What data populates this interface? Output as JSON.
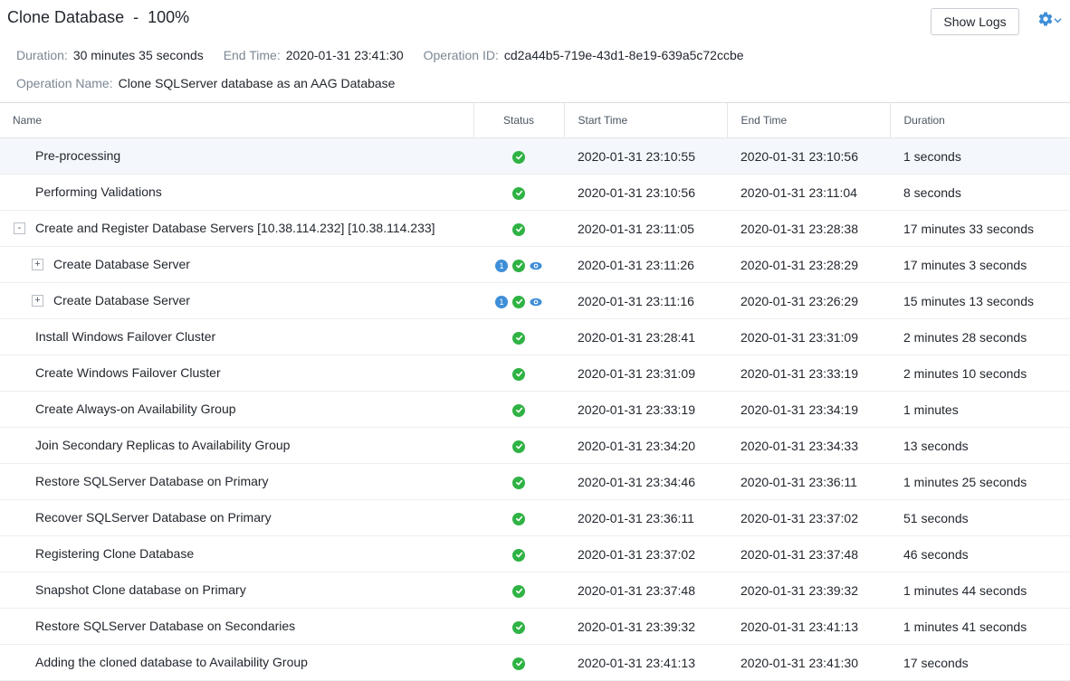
{
  "header": {
    "title": "Clone Database",
    "title_sep": "-",
    "progress": "100%",
    "show_logs_label": "Show Logs",
    "meta": {
      "duration_label": "Duration:",
      "duration_value": "30 minutes 35 seconds",
      "end_time_label": "End Time:",
      "end_time_value": "2020-01-31 23:41:30",
      "operation_id_label": "Operation ID:",
      "operation_id_value": "cd2a44b5-719e-43d1-8e19-639a5c72ccbe",
      "operation_name_label": "Operation Name:",
      "operation_name_value": "Clone SQLServer database as an AAG Database"
    }
  },
  "table": {
    "columns": [
      "Name",
      "Status",
      "Start Time",
      "End Time",
      "Duration"
    ],
    "rows": [
      {
        "name": "Pre-processing",
        "start": "2020-01-31 23:10:55",
        "end": "2020-01-31 23:10:56",
        "duration": "1 seconds"
      },
      {
        "name": "Performing Validations",
        "start": "2020-01-31 23:10:56",
        "end": "2020-01-31 23:11:04",
        "duration": "8 seconds"
      },
      {
        "name": "Create and Register Database Servers [10.38.114.232] [10.38.114.233]",
        "toggle": "-",
        "start": "2020-01-31 23:11:05",
        "end": "2020-01-31 23:28:38",
        "duration": "17 minutes 33 seconds"
      },
      {
        "name": "Create Database Server",
        "toggle": "+",
        "info": "1",
        "start": "2020-01-31 23:11:26",
        "end": "2020-01-31 23:28:29",
        "duration": "17 minutes 3 seconds"
      },
      {
        "name": "Create Database Server",
        "toggle": "+",
        "info": "1",
        "start": "2020-01-31 23:11:16",
        "end": "2020-01-31 23:26:29",
        "duration": "15 minutes 13 seconds"
      },
      {
        "name": "Install Windows Failover Cluster",
        "start": "2020-01-31 23:28:41",
        "end": "2020-01-31 23:31:09",
        "duration": "2 minutes 28 seconds"
      },
      {
        "name": "Create Windows Failover Cluster",
        "start": "2020-01-31 23:31:09",
        "end": "2020-01-31 23:33:19",
        "duration": "2 minutes 10 seconds"
      },
      {
        "name": "Create Always-on Availability Group",
        "start": "2020-01-31 23:33:19",
        "end": "2020-01-31 23:34:19",
        "duration": "1 minutes"
      },
      {
        "name": "Join Secondary Replicas to Availability Group",
        "start": "2020-01-31 23:34:20",
        "end": "2020-01-31 23:34:33",
        "duration": "13 seconds"
      },
      {
        "name": "Restore SQLServer Database on Primary",
        "start": "2020-01-31 23:34:46",
        "end": "2020-01-31 23:36:11",
        "duration": "1 minutes 25 seconds"
      },
      {
        "name": "Recover SQLServer Database on Primary",
        "start": "2020-01-31 23:36:11",
        "end": "2020-01-31 23:37:02",
        "duration": "51 seconds"
      },
      {
        "name": "Registering Clone Database",
        "start": "2020-01-31 23:37:02",
        "end": "2020-01-31 23:37:48",
        "duration": "46 seconds"
      },
      {
        "name": "Snapshot Clone database on Primary",
        "start": "2020-01-31 23:37:48",
        "end": "2020-01-31 23:39:32",
        "duration": "1 minutes 44 seconds"
      },
      {
        "name": "Restore SQLServer Database on Secondaries",
        "start": "2020-01-31 23:39:32",
        "end": "2020-01-31 23:41:13",
        "duration": "1 minutes 41 seconds"
      },
      {
        "name": "Adding the cloned database to Availability Group",
        "start": "2020-01-31 23:41:13",
        "end": "2020-01-31 23:41:30",
        "duration": "17 seconds"
      }
    ]
  },
  "colors": {
    "success": "#2fb344",
    "info": "#3e8ed8",
    "accent": "#3e8ed8"
  },
  "icons": {
    "status_ok": "check-circle-icon",
    "info": "info-badge-icon",
    "view": "eye-icon",
    "settings": "gear-icon"
  }
}
